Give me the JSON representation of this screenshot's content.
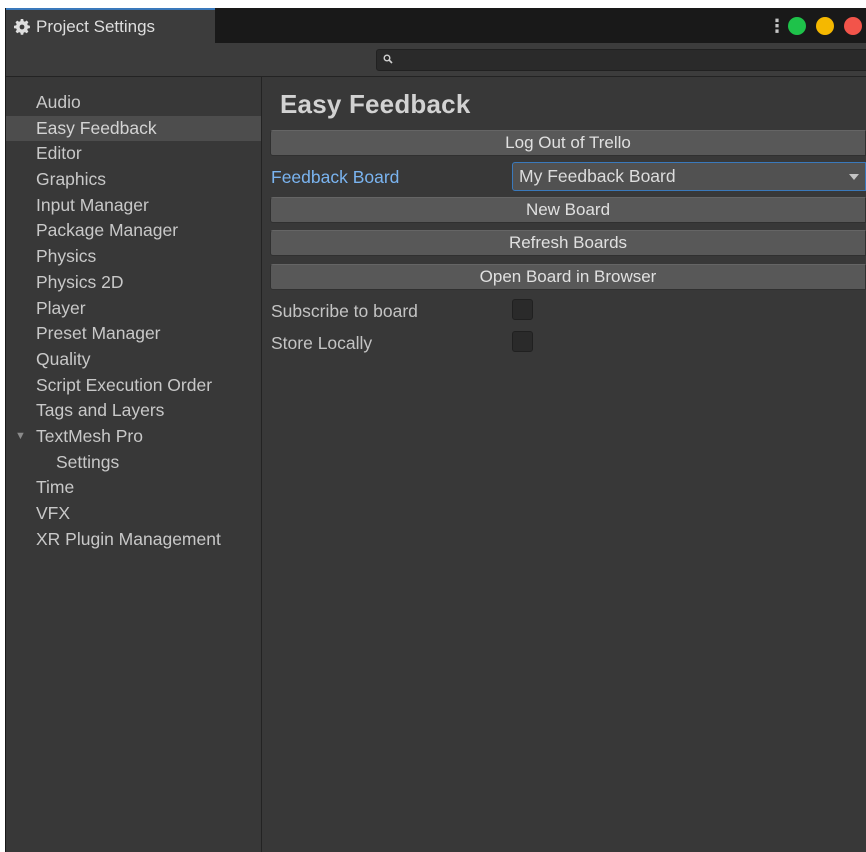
{
  "window": {
    "tab_title": "Project Settings",
    "tab_icon": "gear-icon",
    "controls": {
      "menu_icon": "kebab-menu-icon",
      "dots": [
        {
          "name": "maximize-dot",
          "color": "#1ec24a"
        },
        {
          "name": "minimize-dot",
          "color": "#f5b800"
        },
        {
          "name": "close-dot",
          "color": "#f2544a"
        }
      ]
    }
  },
  "search": {
    "placeholder": "",
    "value": "",
    "icon": "search-icon"
  },
  "sidebar": {
    "items": [
      {
        "label": "Audio"
      },
      {
        "label": "Easy Feedback",
        "selected": true
      },
      {
        "label": "Editor"
      },
      {
        "label": "Graphics"
      },
      {
        "label": "Input Manager"
      },
      {
        "label": "Package Manager"
      },
      {
        "label": "Physics"
      },
      {
        "label": "Physics 2D"
      },
      {
        "label": "Player"
      },
      {
        "label": "Preset Manager"
      },
      {
        "label": "Quality"
      },
      {
        "label": "Script Execution Order"
      },
      {
        "label": "Tags and Layers"
      },
      {
        "label": "TextMesh Pro",
        "expanded": true
      },
      {
        "label": "Settings",
        "child": true
      },
      {
        "label": "Time"
      },
      {
        "label": "VFX"
      },
      {
        "label": "XR Plugin Management"
      }
    ]
  },
  "main": {
    "title": "Easy Feedback",
    "log_out_button": "Log Out of Trello",
    "feedback_board_label": "Feedback Board",
    "feedback_board_value": "My Feedback Board",
    "new_board_button": "New Board",
    "refresh_boards_button": "Refresh Boards",
    "open_board_button": "Open Board in Browser",
    "subscribe_label": "Subscribe to board",
    "subscribe_checked": false,
    "store_locally_label": "Store Locally",
    "store_locally_checked": false
  },
  "colors": {
    "accent": "#3a79bb",
    "active_label": "#7ab4f0",
    "panel_bg": "#383838"
  }
}
